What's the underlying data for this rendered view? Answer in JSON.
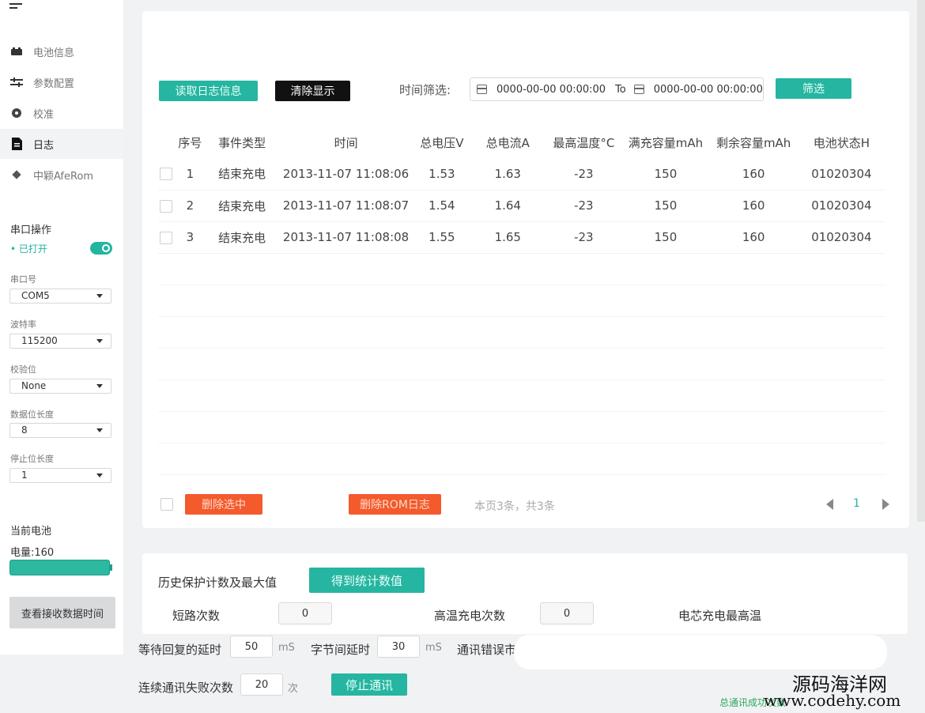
{
  "sidebar": {
    "items": [
      {
        "label": "电池信息",
        "icon": "battery-icon"
      },
      {
        "label": "参数配置",
        "icon": "sliders-icon"
      },
      {
        "label": "校准",
        "icon": "gear-icon"
      },
      {
        "label": "日志",
        "icon": "document-icon"
      },
      {
        "label": "中颖AfeRom",
        "icon": "chip-icon"
      }
    ],
    "serial": {
      "title": "串口操作",
      "status": "• 已打开",
      "port_label": "串口号",
      "port_value": "COM5",
      "baud_label": "波特率",
      "baud_value": "115200",
      "parity_label": "校验位",
      "parity_value": "None",
      "databits_label": "数据位长度",
      "databits_value": "8",
      "stopbits_label": "停止位长度",
      "stopbits_value": "1"
    },
    "battery": {
      "title": "当前电池",
      "level_text": "电量:160",
      "level_fraction": 1.0
    },
    "view_time_button": "查看接收数据时间"
  },
  "toolbar": {
    "read_log": "读取日志信息",
    "clear_display": "清除显示",
    "filter_label": "时间筛选:",
    "date_from": "0000-00-00 00:00:00",
    "date_to_label": "To",
    "date_to": "0000-00-00 00:00:00",
    "filter_button": "筛选"
  },
  "table": {
    "headers": [
      "序号",
      "事件类型",
      "时间",
      "总电压V",
      "总电流A",
      "最高温度°C",
      "满充容量mAh",
      "剩余容量mAh",
      "电池状态H"
    ],
    "rows": [
      [
        "1",
        "结束充电",
        "2013-11-07 11:08:06",
        "1.53",
        "1.63",
        "-23",
        "150",
        "160",
        "01020304"
      ],
      [
        "2",
        "结束充电",
        "2013-11-07 11:08:07",
        "1.54",
        "1.64",
        "-23",
        "150",
        "160",
        "01020304"
      ],
      [
        "3",
        "结束充电",
        "2013-11-07 11:08:08",
        "1.55",
        "1.65",
        "-23",
        "150",
        "160",
        "01020304"
      ]
    ]
  },
  "footer_actions": {
    "delete_selected": "删除选中",
    "delete_rom_log": "删除ROM日志",
    "page_info": "本页3条，共3条",
    "current_page": "1"
  },
  "stats": {
    "title": "历史保护计数及最大值",
    "get_button": "得到统计数值",
    "short_circuit_label": "短路次数",
    "short_circuit_value": "0",
    "high_temp_charge_label": "高温充电次数",
    "high_temp_charge_value": "0",
    "cell_max_temp_label": "电芯充电最高温"
  },
  "comm": {
    "reply_delay_label": "等待回复的延时",
    "reply_delay_value": "50",
    "reply_delay_unit": "mS",
    "byte_delay_label": "字节间延时",
    "byte_delay_value": "30",
    "byte_delay_unit": "mS",
    "error_label": "通讯错误市",
    "fail_count_label": "连续通讯失败次数",
    "fail_count_value": "20",
    "fail_count_unit": "次",
    "stop_button": "停止通讯"
  },
  "watermark": {
    "cn": "源码海洋网",
    "en": "www.codehy.com"
  },
  "footer_status": "总通讯成功次数"
}
